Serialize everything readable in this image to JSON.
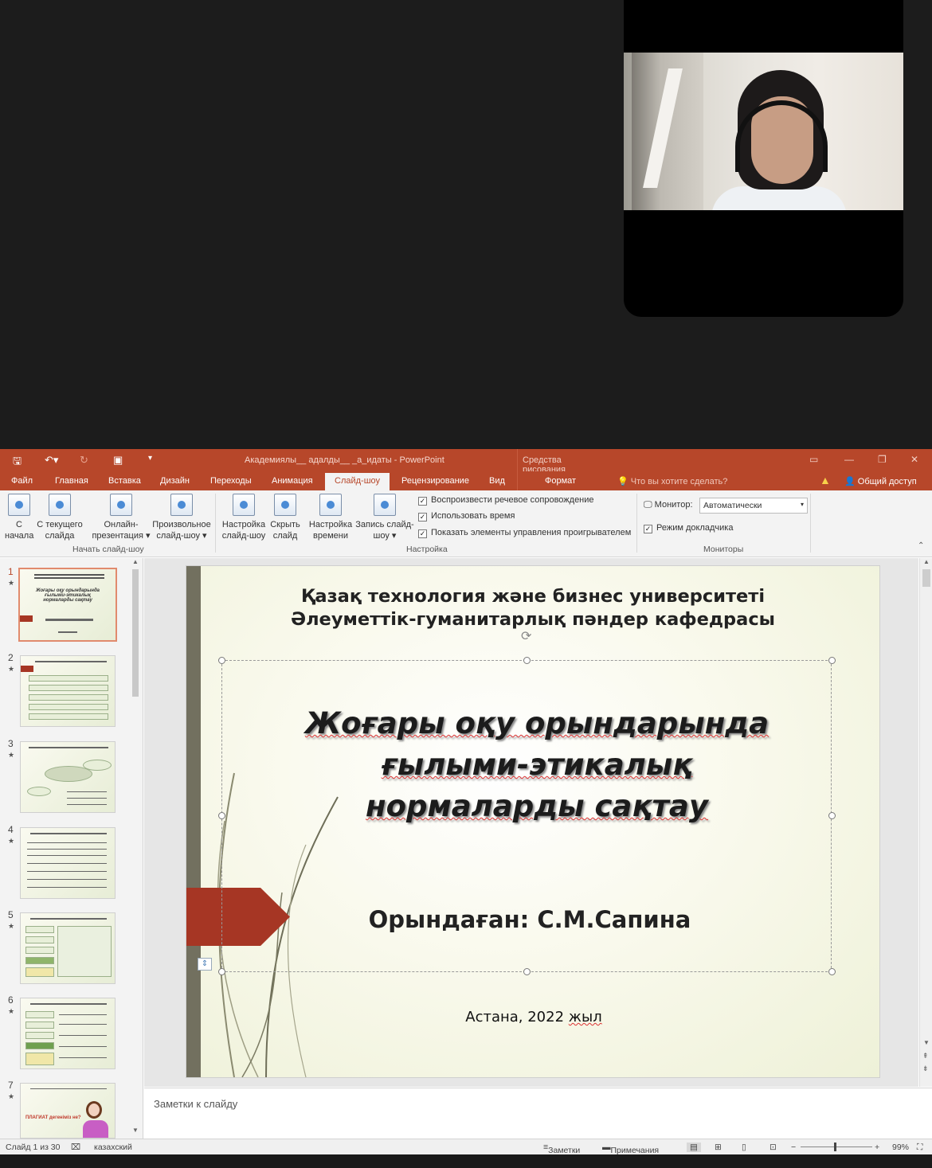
{
  "app": {
    "doc_title": "Академиялы__ адалды__ _а_идаты - PowerPoint",
    "context_tab_group": "Средства рисования"
  },
  "tabs": [
    "Файл",
    "Главная",
    "Вставка",
    "Дизайн",
    "Переходы",
    "Анимация",
    "Слайд-шоу",
    "Рецензирование",
    "Вид"
  ],
  "active_tab": "Слайд-шоу",
  "format_tab": "Формат",
  "tell_me": "Что вы хотите сделать?",
  "share": "Общий доступ",
  "ribbon": {
    "start": {
      "from_start": [
        "С",
        "начала"
      ],
      "from_current": [
        "С текущего",
        "слайда"
      ],
      "online": [
        "Онлайн-",
        "презентация ▾"
      ],
      "custom": [
        "Произвольное",
        "слайд-шоу ▾"
      ],
      "label": "Начать слайд-шоу"
    },
    "setup": {
      "setup_show": [
        "Настройка",
        "слайд-шоу"
      ],
      "hide_slide": [
        "Скрыть",
        "слайд"
      ],
      "rehearse": [
        "Настройка",
        "времени"
      ],
      "record": [
        "Запись слайд-",
        "шоу ▾"
      ],
      "checks": [
        "Воспроизвести речевое сопровождение",
        "Использовать время",
        "Показать элементы управления проигрывателем"
      ],
      "label": "Настройка"
    },
    "monitors": {
      "monitor_label": "Монитор:",
      "monitor_value": "Автоматически",
      "presenter_view": "Режим докладчика",
      "label": "Мониторы"
    }
  },
  "thumbnails": [
    {
      "num": "1",
      "text": "Жоғары оқу орындарында ғылыми-этикалық нормаларды сақтау"
    },
    {
      "num": "2"
    },
    {
      "num": "3"
    },
    {
      "num": "4"
    },
    {
      "num": "5"
    },
    {
      "num": "6"
    },
    {
      "num": "7",
      "text": "ПЛАГИАТ дегеніміз не?"
    }
  ],
  "slide": {
    "university_line1": "Қазақ технология және бизнес университеті",
    "university_line2": "Әлеуметтік-гуманитарлық пәндер кафедрасы",
    "title_line1": "Жоғары оқу орындарында",
    "title_line2": "ғылыми-этикалық",
    "title_line3": "нормаларды сақтау",
    "author": "Орындаған: С.М.Сапина",
    "city_year": "Астана, 2022",
    "year_word": "жыл"
  },
  "notes_placeholder": "Заметки к слайду",
  "status": {
    "slide_counter": "Слайд 1 из 30",
    "language": "казахский",
    "notes": "Заметки",
    "comments": "Примечания",
    "zoom": "99%"
  }
}
